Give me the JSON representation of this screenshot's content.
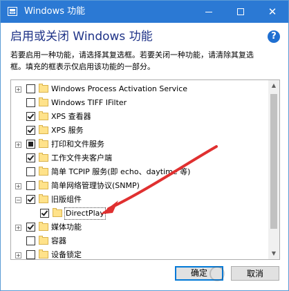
{
  "window": {
    "title": "Windows 功能",
    "heading": "启用或关闭 Windows 功能",
    "description_lines": [
      "若要启用一种功能，请选择其复选框。若要关闭一种功能，请清除其复选",
      "框。填充的框表示仅启用该功能的一部分。"
    ]
  },
  "icons": {
    "app": "windows-features-icon",
    "help": "help-icon",
    "minimize": "minimize-icon",
    "maximize": "maximize-icon",
    "close": "close-icon",
    "folder": "folder-icon",
    "close_glyph": "✕",
    "help_glyph": "?"
  },
  "features": [
    {
      "label": "Windows Process Activation Service",
      "expander": "+",
      "state": "unchecked",
      "level": 0
    },
    {
      "label": "Windows TIFF IFilter",
      "expander": "",
      "state": "unchecked",
      "level": 0
    },
    {
      "label": "XPS 查看器",
      "expander": "",
      "state": "checked",
      "level": 0
    },
    {
      "label": "XPS 服务",
      "expander": "",
      "state": "checked",
      "level": 0
    },
    {
      "label": "打印和文件服务",
      "expander": "+",
      "state": "partial",
      "level": 0
    },
    {
      "label": "工作文件夹客户端",
      "expander": "",
      "state": "checked",
      "level": 0
    },
    {
      "label": "简单 TCPIP 服务(即 echo、daytime 等)",
      "expander": "",
      "state": "unchecked",
      "level": 0
    },
    {
      "label": "简单网络管理协议(SNMP)",
      "expander": "+",
      "state": "unchecked",
      "level": 0
    },
    {
      "label": "旧版组件",
      "expander": "−",
      "state": "checked",
      "level": 0
    },
    {
      "label": "DirectPlay",
      "expander": "",
      "state": "checked",
      "level": 1,
      "selected": true
    },
    {
      "label": "媒体功能",
      "expander": "+",
      "state": "checked",
      "level": 0
    },
    {
      "label": "容器",
      "expander": "",
      "state": "unchecked",
      "level": 0
    },
    {
      "label": "设备锁定",
      "expander": "+",
      "state": "unchecked",
      "level": 0
    }
  ],
  "buttons": {
    "ok": "确定",
    "cancel": "取消"
  },
  "scrollbar": {
    "up_glyph": "▲",
    "down_glyph": "▼"
  },
  "colors": {
    "titlebar": "#2b79d4",
    "heading": "#1e3287",
    "annotation_arrow": "#e03030"
  }
}
